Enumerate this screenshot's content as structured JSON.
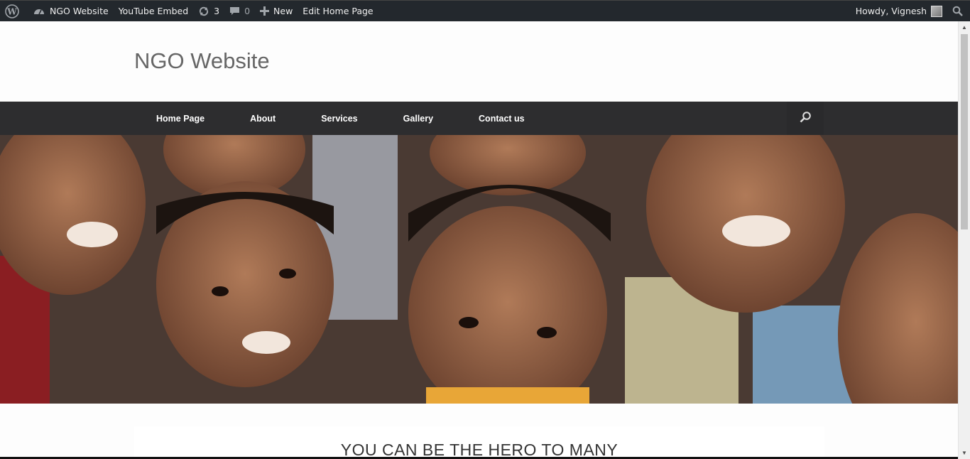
{
  "adminbar": {
    "site_name": "NGO Website",
    "youtube": "YouTube Embed",
    "updates_count": "3",
    "comments_count": "0",
    "new_label": "New",
    "edit_label": "Edit Home Page",
    "howdy": "Howdy, Vignesh"
  },
  "header": {
    "site_title": "NGO Website"
  },
  "nav": {
    "items": [
      {
        "label": "Home Page"
      },
      {
        "label": "About"
      },
      {
        "label": "Services"
      },
      {
        "label": "Gallery"
      },
      {
        "label": "Contact us"
      }
    ]
  },
  "content": {
    "headline": "YOU CAN BE THE HERO TO MANY"
  },
  "colors": {
    "adminbar_bg": "#23282d",
    "nav_bg": "#2d2d2f",
    "title": "#666666"
  },
  "icons": [
    "wordpress-icon",
    "dashboard-icon",
    "updates-icon",
    "comment-icon",
    "plus-icon",
    "search-icon"
  ]
}
